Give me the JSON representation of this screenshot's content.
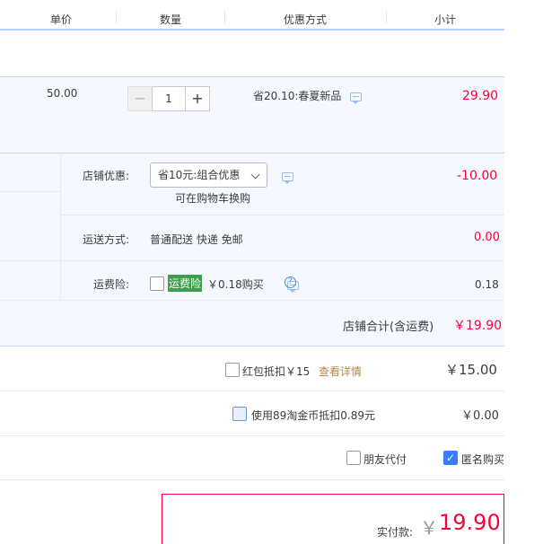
{
  "header": {
    "col_price": "单价",
    "col_qty": "数量",
    "col_promo": "优惠方式",
    "col_subtotal": "小计"
  },
  "item": {
    "price": "50.00",
    "quantity": "1",
    "promo_text": "省20.10:春夏新品",
    "subtotal": "29.90"
  },
  "store": {
    "discount_label": "店铺优惠:",
    "discount_select": "省10元:组合优惠",
    "discount_hint": "可在购物车换购",
    "discount_value": "-10.00",
    "shipping_label": "运送方式:",
    "shipping_text": "普通配送 快递 免邮",
    "shipping_value": "0.00",
    "insurance_label": "运费险:",
    "insurance_tag": "运费险",
    "insurance_text": "￥0.18购买",
    "insurance_value": "0.18",
    "total_label": "店铺合计(含运费)",
    "total_value": "￥19.90"
  },
  "redpacket": {
    "label": "红包抵扣￥15",
    "link": "查看详情",
    "value": "￥15.00"
  },
  "coins": {
    "label": "使用89淘金币抵扣0.89元",
    "value": "￥0.00"
  },
  "options": {
    "friend_pay": "朋友代付",
    "anonymous": "匿名购买"
  },
  "payment": {
    "label": "实付款:",
    "currency": "￥",
    "amount": "19.90"
  },
  "colors": {
    "accent_red": "#ff0036",
    "checkbox_blue": "#3b7cff",
    "insurance_green": "#3c9f4a",
    "link_brown": "#b58550"
  }
}
